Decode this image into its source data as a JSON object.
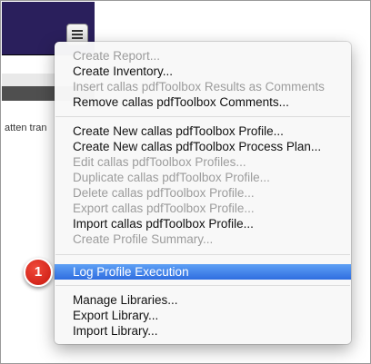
{
  "background": {
    "partial_text": "atten tran"
  },
  "badge": {
    "number": "1",
    "color": "#d61f14"
  },
  "menu": {
    "selected_color": "#3b7ded",
    "items": [
      {
        "label": "Create Report...",
        "enabled": false
      },
      {
        "label": "Create Inventory...",
        "enabled": true
      },
      {
        "label": "Insert callas pdfToolbox Results as Comments",
        "enabled": false
      },
      {
        "label": "Remove callas pdfToolbox Comments...",
        "enabled": true
      },
      {
        "label": "Create New callas pdfToolbox Profile...",
        "enabled": true
      },
      {
        "label": "Create New callas pdfToolbox Process Plan...",
        "enabled": true
      },
      {
        "label": "Edit callas pdfToolbox Profiles...",
        "enabled": false
      },
      {
        "label": "Duplicate callas pdfToolbox Profile...",
        "enabled": false
      },
      {
        "label": "Delete callas pdfToolbox Profile...",
        "enabled": false
      },
      {
        "label": "Export callas pdfToolbox Profile...",
        "enabled": false
      },
      {
        "label": "Import callas pdfToolbox Profile...",
        "enabled": true
      },
      {
        "label": "Create Profile Summary...",
        "enabled": false
      },
      {
        "label": "Log Profile Execution",
        "enabled": true,
        "selected": true
      },
      {
        "label": "Manage Libraries...",
        "enabled": true
      },
      {
        "label": "Export Library...",
        "enabled": true
      },
      {
        "label": "Import Library...",
        "enabled": true
      }
    ]
  }
}
